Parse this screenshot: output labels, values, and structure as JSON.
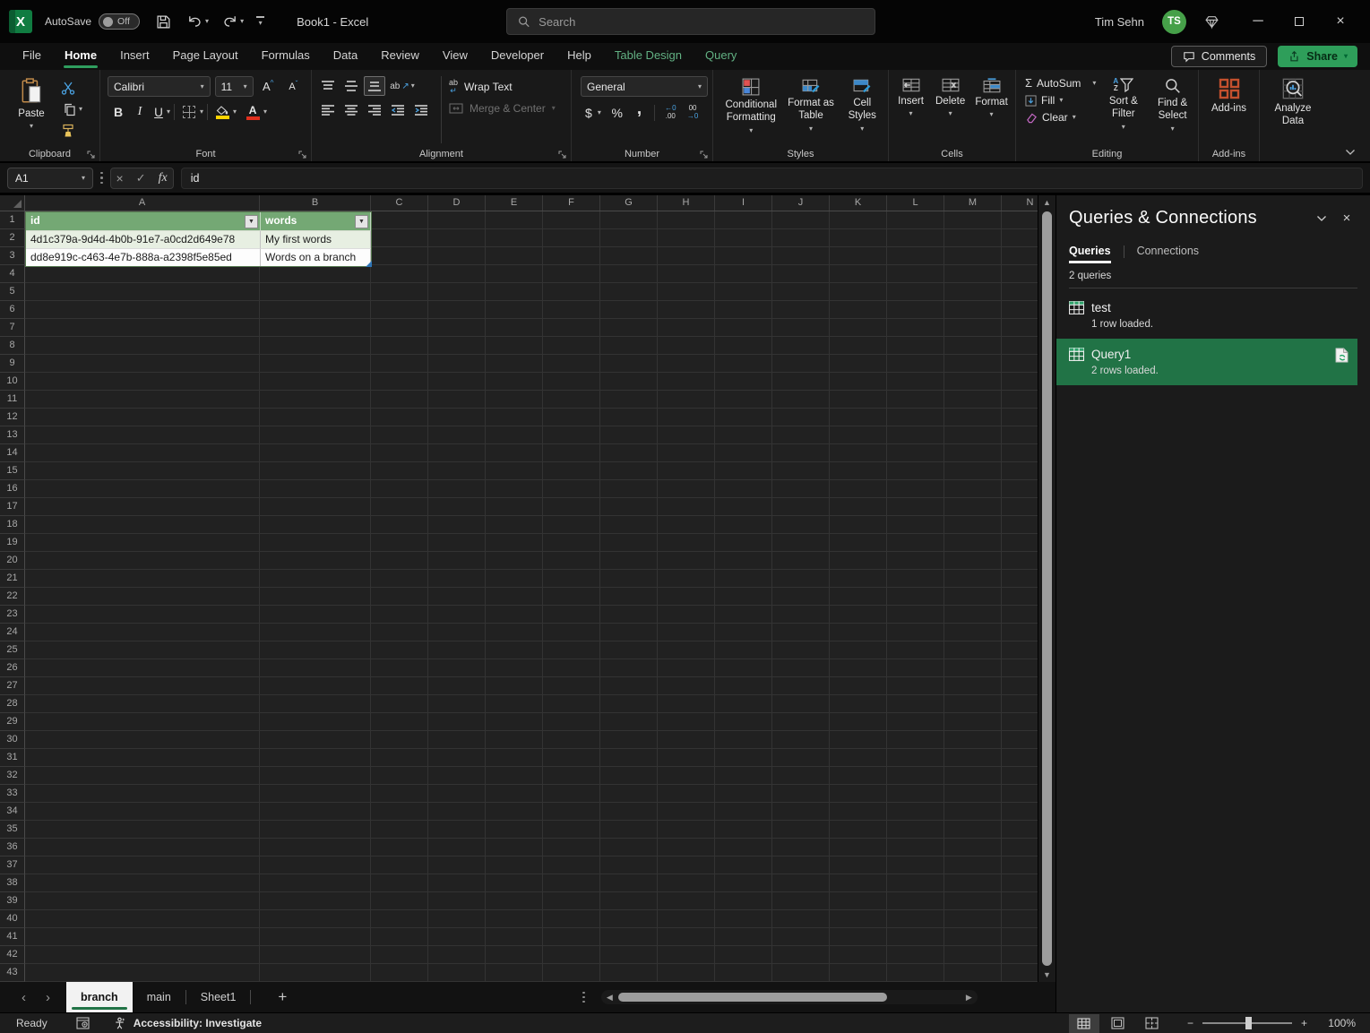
{
  "titlebar": {
    "autosave_label": "AutoSave",
    "autosave_state": "Off",
    "doc_title": "Book1 - Excel",
    "search_placeholder": "Search",
    "user_name": "Tim Sehn",
    "user_initials": "TS"
  },
  "ribbon_tabs": [
    "File",
    "Home",
    "Insert",
    "Page Layout",
    "Formulas",
    "Data",
    "Review",
    "View",
    "Developer",
    "Help",
    "Table Design",
    "Query"
  ],
  "ribbon_actions": {
    "comments": "Comments",
    "share": "Share"
  },
  "ribbon": {
    "clipboard": {
      "group": "Clipboard",
      "paste": "Paste"
    },
    "font": {
      "group": "Font",
      "font_name": "Calibri",
      "font_size": "11"
    },
    "alignment": {
      "group": "Alignment",
      "wrap_text": "Wrap Text",
      "merge_center": "Merge & Center"
    },
    "number": {
      "group": "Number",
      "format": "General"
    },
    "styles": {
      "group": "Styles",
      "conditional_formatting": "Conditional Formatting",
      "format_as_table": "Format as Table",
      "cell_styles": "Cell Styles"
    },
    "cells": {
      "group": "Cells",
      "insert": "Insert",
      "delete": "Delete",
      "format": "Format"
    },
    "editing": {
      "group": "Editing",
      "autosum": "AutoSum",
      "fill": "Fill",
      "clear": "Clear",
      "sort_filter": "Sort & Filter",
      "find_select": "Find & Select"
    },
    "addins": {
      "group": "Add-ins",
      "addins": "Add-ins",
      "analyze": "Analyze Data"
    }
  },
  "glyphs": {
    "fx": "fx",
    "sigma": "Σ",
    "dollar": "$",
    "percent": "%",
    "comma": ",",
    "bold": "B",
    "italic": "I",
    "underline": "U",
    "letter_a": "A",
    "ab": "ab",
    "inc_dec_top": "←0",
    "inc_dec_bot": ".00",
    "dec_dec_top": "00",
    "dec_dec_bot": "→0",
    "sort_a": "A",
    "sort_z": "Z",
    "plus": "+",
    "minus": "−",
    "add_sheet": "+"
  },
  "formula_bar": {
    "name_box": "A1",
    "formula": "id"
  },
  "grid": {
    "columns": [
      "A",
      "B",
      "C",
      "D",
      "E",
      "F",
      "G",
      "H",
      "I",
      "J",
      "K",
      "L",
      "M",
      "N"
    ],
    "rows": [
      "1",
      "2",
      "3",
      "4",
      "5",
      "6",
      "7",
      "8",
      "9",
      "10",
      "11",
      "12",
      "13",
      "14",
      "15",
      "16",
      "17",
      "18",
      "19",
      "20",
      "21",
      "22",
      "23",
      "24",
      "25",
      "26",
      "27",
      "28",
      "29",
      "30",
      "31",
      "32",
      "33",
      "34",
      "35",
      "36",
      "37",
      "38",
      "39",
      "40",
      "41",
      "42",
      "43"
    ],
    "table": {
      "headers": [
        "id",
        "words"
      ],
      "rows": [
        [
          "4d1c379a-9d4d-4b0b-91e7-a0cd2d649e78",
          "My first words"
        ],
        [
          "dd8e919c-c463-4e7b-888a-a2398f5e85ed",
          "Words on a branch"
        ]
      ]
    }
  },
  "panel": {
    "title": "Queries & Connections",
    "tab_queries": "Queries",
    "tab_connections": "Connections",
    "count_label": "2 queries",
    "queries": [
      {
        "name": "test",
        "status": "1 row loaded."
      },
      {
        "name": "Query1",
        "status": "2 rows loaded."
      }
    ]
  },
  "sheet_bar": {
    "tabs": [
      "branch",
      "main",
      "Sheet1"
    ]
  },
  "status_bar": {
    "ready": "Ready",
    "accessibility": "Accessibility: Investigate",
    "zoom": "100%"
  },
  "colors": {
    "accent_green": "#217346",
    "table_header": "#74a874",
    "share_green": "#2e9e5a"
  }
}
